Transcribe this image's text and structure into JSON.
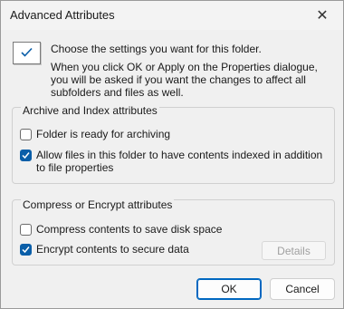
{
  "window": {
    "title": "Advanced Attributes",
    "close_glyph": "✕"
  },
  "header": {
    "icon": "folder-settings-check-icon",
    "line1": "Choose the settings you want for this folder.",
    "line2": "When you click OK or Apply on the Properties dialogue, you will be asked if you want the changes to affect all subfolders and files as well."
  },
  "archive_group": {
    "label": "Archive and Index attributes",
    "options": [
      {
        "label": "Folder is ready for archiving",
        "checked": false
      },
      {
        "label": "Allow files in this folder to have contents indexed in addition to file properties",
        "checked": true
      }
    ]
  },
  "compress_group": {
    "label": "Compress or Encrypt attributes",
    "options": [
      {
        "label": "Compress contents to save disk space",
        "checked": false
      },
      {
        "label": "Encrypt contents to secure data",
        "checked": true
      }
    ],
    "details_label": "Details"
  },
  "buttons": {
    "ok": "OK",
    "cancel": "Cancel"
  },
  "colors": {
    "accent": "#0a5ea8",
    "focus_border": "#0067c0",
    "background": "#f0f0f0"
  }
}
